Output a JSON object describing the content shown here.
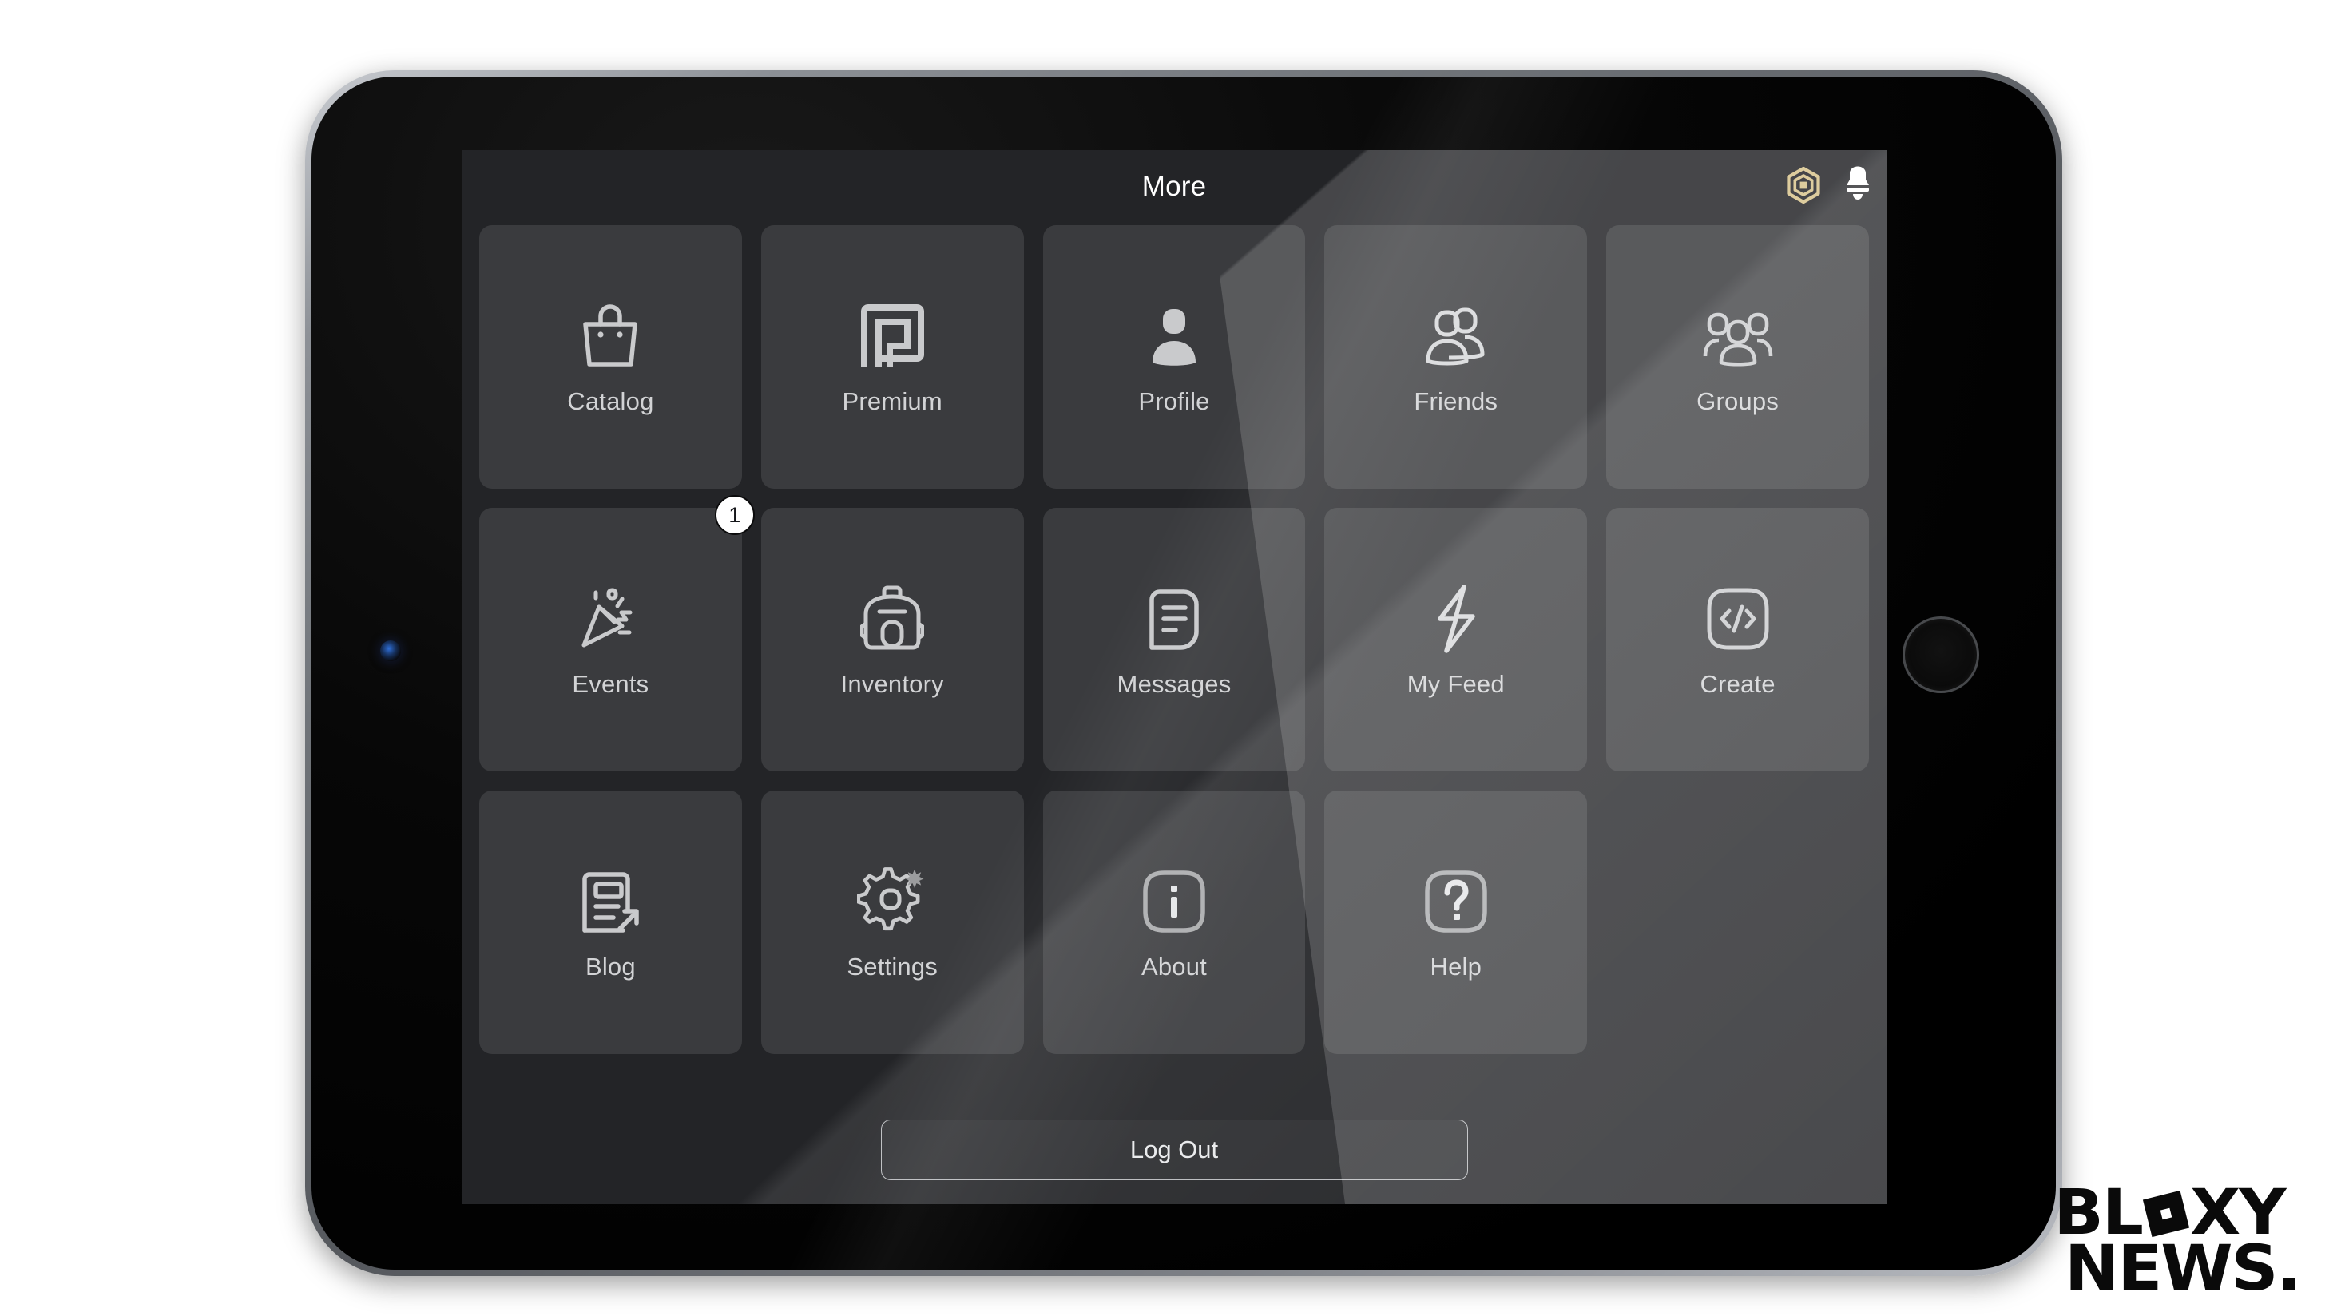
{
  "device": {
    "kind": "tablet",
    "home_button": "home-button",
    "front_camera": "front-camera"
  },
  "screen": {
    "header": {
      "title": "More",
      "icons": [
        {
          "name": "robux-icon",
          "label": "Robux"
        },
        {
          "name": "notification-bell-icon",
          "label": "Notifications"
        }
      ]
    },
    "grid": {
      "rows": 3,
      "columns": 5,
      "tiles": [
        {
          "label": "Catalog",
          "icon": "shopping-bag-icon",
          "badge": null,
          "highlighted": false
        },
        {
          "label": "Premium",
          "icon": "premium-p-icon",
          "badge": null,
          "highlighted": false
        },
        {
          "label": "Profile",
          "icon": "person-icon",
          "badge": null,
          "highlighted": false
        },
        {
          "label": "Friends",
          "icon": "two-people-icon",
          "badge": null,
          "highlighted": false
        },
        {
          "label": "Groups",
          "icon": "three-people-icon",
          "badge": null,
          "highlighted": false
        },
        {
          "label": "Events",
          "icon": "party-popper-icon",
          "badge": "1",
          "highlighted": false
        },
        {
          "label": "Inventory",
          "icon": "backpack-icon",
          "badge": null,
          "highlighted": false
        },
        {
          "label": "Messages",
          "icon": "chat-bubble-icon",
          "badge": null,
          "highlighted": false
        },
        {
          "label": "My Feed",
          "icon": "lightning-bolt-icon",
          "badge": null,
          "highlighted": false
        },
        {
          "label": "Create",
          "icon": "code-brackets-icon",
          "badge": null,
          "highlighted": false
        },
        {
          "label": "Blog",
          "icon": "newspaper-arrow-icon",
          "badge": null,
          "highlighted": false
        },
        {
          "label": "Settings",
          "icon": "gear-star-icon",
          "badge": null,
          "highlighted": false
        },
        {
          "label": "About",
          "icon": "info-icon",
          "badge": null,
          "highlighted": false
        },
        {
          "label": "Help",
          "icon": "question-mark-icon",
          "badge": null,
          "highlighted": false
        }
      ]
    },
    "logout_button": {
      "label": "Log Out"
    }
  },
  "watermark": {
    "line1_before": "BL",
    "line1_after": "XY",
    "line2": "NEWS.",
    "logo_icon": "roblox-square-icon"
  },
  "colors": {
    "screen_background": "#232427",
    "tile_background": "#3a3b3e",
    "icon_grey": "#c9cacc",
    "label_grey": "#d2d3d5",
    "robux_gold": "#d6c28a",
    "badge_background": "#ffffff",
    "watermark_black": "#0a0a0a"
  }
}
